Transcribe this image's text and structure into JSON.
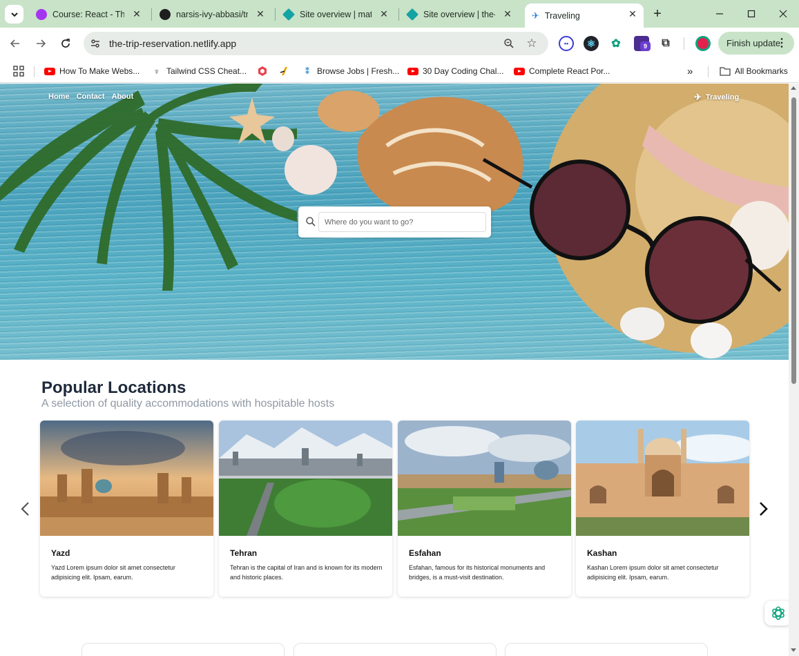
{
  "browser": {
    "tabs": [
      {
        "title": "Course: React - The Complete Guide",
        "active": false
      },
      {
        "title": "narsis-ivy-abbasi/trip-reservation",
        "active": false
      },
      {
        "title": "Site overview | math",
        "active": false
      },
      {
        "title": "Site overview | the-trip",
        "active": false
      },
      {
        "title": "Traveling",
        "active": true
      }
    ],
    "new_tab_label": "+",
    "url": "the-trip-reservation.netlify.app",
    "finish_update_label": "Finish update",
    "extension_badge": "9",
    "bookmarks": [
      {
        "label": "How To Make Webs...",
        "icon": "youtube-icon"
      },
      {
        "label": "Tailwind CSS Cheat...",
        "icon": "tailwind-icon"
      },
      {
        "label": "",
        "icon": "hex-icon"
      },
      {
        "label": "",
        "icon": "codepen-icon"
      },
      {
        "label": "Browse Jobs | Fresh...",
        "icon": "jobs-icon"
      },
      {
        "label": "30 Day Coding Chal...",
        "icon": "youtube-icon"
      },
      {
        "label": "Complete React Por...",
        "icon": "youtube-icon"
      }
    ],
    "all_bookmarks_label": "All Bookmarks"
  },
  "site": {
    "nav": [
      {
        "label": "Home"
      },
      {
        "label": "Contact"
      },
      {
        "label": "About"
      }
    ],
    "brand": "Traveling",
    "search_placeholder": "Where do you want to go?",
    "popular": {
      "title": "Popular Locations",
      "subtitle": "A selection of quality accommodations with hospitable hosts"
    },
    "cards": [
      {
        "title": "Yazd",
        "text": "Yazd Lorem ipsum dolor sit amet consectetur adipisicing elit. Ipsam, earum."
      },
      {
        "title": "Tehran",
        "text": "Tehran is the capital of Iran and is known for its modern and historic places."
      },
      {
        "title": "Esfahan",
        "text": "Esfahan, famous for its historical monuments and bridges, is a must-visit destination."
      },
      {
        "title": "Kashan",
        "text": "Kashan Lorem ipsum dolor sit amet consectetur adipisicing elit. Ipsam, earum."
      }
    ]
  },
  "colors": {
    "tabstrip": "#c9e3c9",
    "hero_water": "#4aa3bd",
    "heading": "#1e2a3b",
    "subheading": "#8f98a3"
  }
}
